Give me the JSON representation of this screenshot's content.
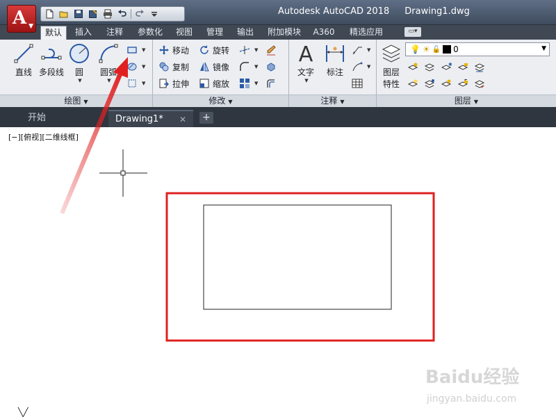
{
  "window": {
    "app_button_label": "A",
    "app_title": "Autodesk AutoCAD 2018",
    "file_name": "Drawing1.dwg"
  },
  "quick_access": {
    "icons": [
      "new-icon",
      "open-icon",
      "save-icon",
      "save-as-icon",
      "plot-icon",
      "undo-icon",
      "redo-icon",
      "qat-menu-icon"
    ]
  },
  "ribbon_tabs": [
    {
      "label": "默认",
      "active": true
    },
    {
      "label": "插入"
    },
    {
      "label": "注释"
    },
    {
      "label": "参数化"
    },
    {
      "label": "视图"
    },
    {
      "label": "管理"
    },
    {
      "label": "输出"
    },
    {
      "label": "附加模块"
    },
    {
      "label": "A360"
    },
    {
      "label": "精选应用"
    }
  ],
  "panels": {
    "draw": {
      "title": "绘图",
      "line": "直线",
      "polyline": "多段线",
      "circle": "圆",
      "arc": "圆弧"
    },
    "modify": {
      "title": "修改",
      "move": "移动",
      "rotate": "旋转",
      "copy": "复制",
      "mirror": "镜像",
      "stretch": "拉伸",
      "scale": "缩放"
    },
    "annotation": {
      "title": "注释",
      "text": "文字",
      "dimension": "标注"
    },
    "layers": {
      "title": "图层",
      "layer_properties_line1": "图层",
      "layer_properties_line2": "特性",
      "current_layer": "0"
    }
  },
  "file_tabs": [
    {
      "label": "开始",
      "active": false
    },
    {
      "label": "Drawing1*",
      "active": true,
      "close": "✕"
    }
  ],
  "new_tab_label": "+",
  "viewport_label": "[−][俯视][二维线框]",
  "watermark": {
    "logo": "Baidu经验",
    "url": "jingyan.baidu.com"
  },
  "colors": {
    "annotation_red": "#e02020",
    "titlebar": "#4a576a",
    "ribbon_bg": "#eceef1",
    "canvas_bg": "#ffffff"
  }
}
